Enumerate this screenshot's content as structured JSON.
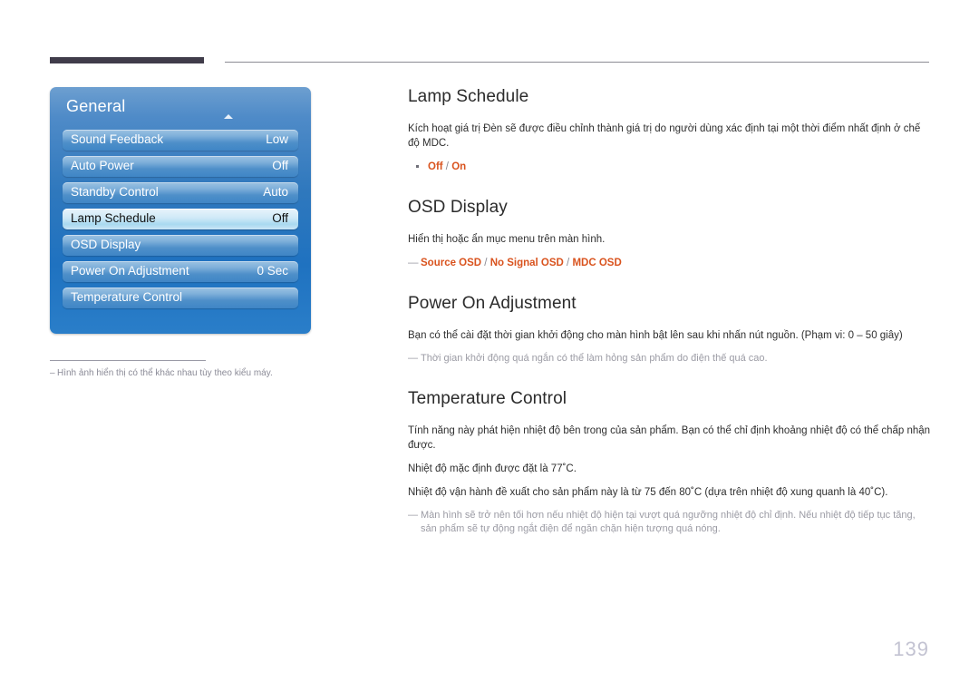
{
  "page": {
    "number": "139"
  },
  "osd_menu": {
    "title": "General",
    "scroll_up_icon": "triangle-up-icon",
    "rows": [
      {
        "label": "Sound Feedback",
        "value": "Low",
        "selected": false
      },
      {
        "label": "Auto Power",
        "value": "Off",
        "selected": false
      },
      {
        "label": "Standby Control",
        "value": "Auto",
        "selected": false
      },
      {
        "label": "Lamp Schedule",
        "value": "Off",
        "selected": true
      },
      {
        "label": "OSD Display",
        "value": "",
        "selected": false
      },
      {
        "label": "Power On Adjustment",
        "value": "0 Sec",
        "selected": false
      },
      {
        "label": "Temperature Control",
        "value": "",
        "selected": false
      }
    ],
    "footnote": "Hình ảnh hiển thị có thể khác nhau tùy theo kiểu máy.",
    "footnote_dash": "–"
  },
  "sections": {
    "lamp_schedule": {
      "heading": "Lamp Schedule",
      "body": "Kích hoạt giá trị Đèn sẽ được điều chỉnh thành giá trị do người dùng xác định tại một thời điểm nhất định ở chế độ MDC.",
      "options": {
        "opt1": "Off",
        "sep1": " / ",
        "opt2": "On"
      }
    },
    "osd_display": {
      "heading": "OSD Display",
      "body": "Hiển thị hoặc ẩn mục menu trên màn hình.",
      "dash": "—",
      "options": {
        "opt1": "Source OSD",
        "sep1": " / ",
        "opt2": "No Signal OSD",
        "sep2": " / ",
        "opt3": "MDC OSD"
      }
    },
    "power_on_adjustment": {
      "heading": "Power On Adjustment",
      "body": "Bạn có thể cài đặt thời gian khởi động cho màn hình bật lên sau khi nhấn nút nguồn. (Phạm vi: 0 – 50 giây)",
      "note_dash": "—",
      "note": "Thời gian khởi động quá ngắn có thể làm hỏng sản phẩm do điện thế quá cao."
    },
    "temperature_control": {
      "heading": "Temperature Control",
      "body1": "Tính năng này phát hiện nhiệt độ bên trong của sản phẩm. Bạn có thể chỉ định khoảng nhiệt độ có thể chấp nhận được.",
      "body2": "Nhiệt độ mặc định được đặt là 77˚C.",
      "body3": "Nhiệt độ vận hành đề xuất cho sản phẩm này là từ 75 đến 80˚C (dựa trên nhiệt độ xung quanh là 40˚C).",
      "note_dash": "—",
      "note": "Màn hình sẽ trở nên tối hơn nếu nhiệt độ hiện tại vượt quá ngưỡng nhiệt độ chỉ định. Nếu nhiệt độ tiếp tục tăng, sản phẩm sẽ tự động ngắt điện để ngăn chặn hiện tượng quá nóng."
    }
  },
  "colors": {
    "accent_orange": "#d9531e",
    "rule_dark": "#403c4a",
    "panel_blue": "#2f78bd",
    "page_number": "#c3c3d2"
  }
}
